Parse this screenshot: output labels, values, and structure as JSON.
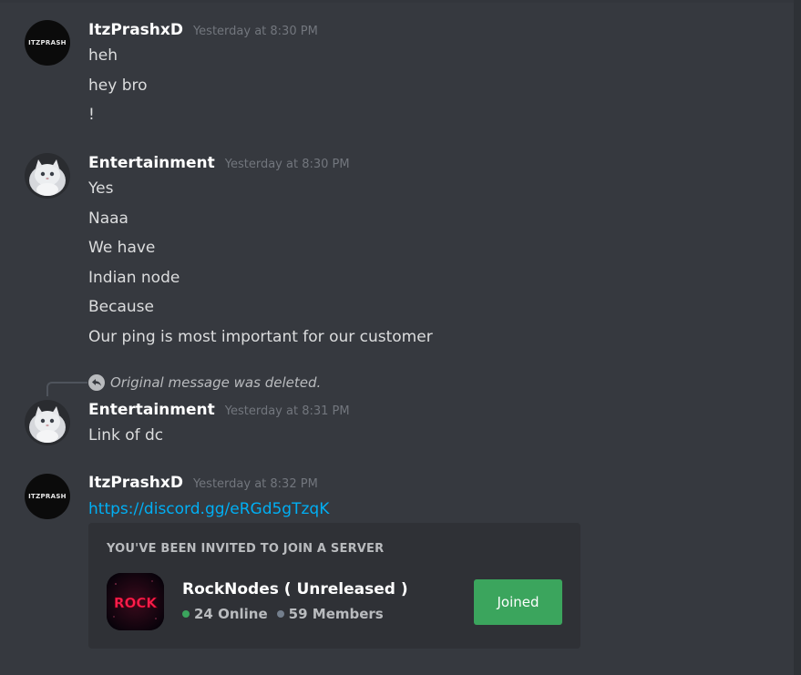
{
  "messages": [
    {
      "author": "ItzPrashxD",
      "timestamp": "Yesterday at 8:30 PM",
      "avatar_text": "ITZPRASH",
      "lines": [
        "heh",
        "hey bro",
        "!"
      ]
    },
    {
      "author": "Entertainment",
      "timestamp": "Yesterday at 8:30 PM",
      "lines": [
        "Yes",
        "Naaa",
        "We have",
        "Indian node",
        "Because",
        "Our ping is most important for our customer"
      ]
    },
    {
      "reply_reference": "Original message was deleted.",
      "author": "Entertainment",
      "timestamp": "Yesterday at 8:31 PM",
      "lines": [
        "Link of dc"
      ]
    },
    {
      "author": "ItzPrashxD",
      "timestamp": "Yesterday at 8:32 PM",
      "avatar_text": "ITZPRASH",
      "link": "https://discord.gg/eRGd5gTzqK",
      "invite": {
        "heading": "YOU'VE BEEN INVITED TO JOIN A SERVER",
        "server_name": "RockNodes ( Unreleased )",
        "icon_text": "ROCK",
        "online": "24 Online",
        "members": "59 Members",
        "button_label": "Joined"
      }
    }
  ],
  "colors": {
    "background": "#36393f",
    "link": "#00aff4",
    "button": "#3ba55d",
    "online": "#3ba55d"
  }
}
